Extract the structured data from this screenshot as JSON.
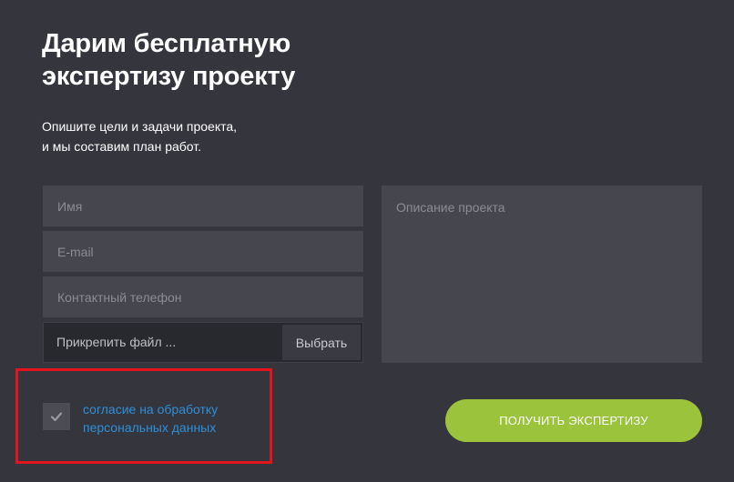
{
  "header": {
    "title_line1": "Дарим бесплатную",
    "title_line2": "экспертизу проекту",
    "subtitle_line1": "Опишите цели и задачи проекта,",
    "subtitle_line2": "и мы составим план работ."
  },
  "form": {
    "name_placeholder": "Имя",
    "email_placeholder": "E-mail",
    "phone_placeholder": "Контактный телефон",
    "file_label": "Прикрепить файл ...",
    "file_button": "Выбрать",
    "description_placeholder": "Описание проекта",
    "consent_line1": "согласие на обработку",
    "consent_line2": "персональных данных",
    "consent_checked": true,
    "submit_label": "ПОЛУЧИТЬ ЭКСПЕРТИЗУ"
  },
  "colors": {
    "background": "#35353d",
    "field": "#46464e",
    "accent_green": "#9bc33b",
    "link_blue": "#2f8fd8",
    "highlight_red": "#e3141b"
  },
  "icons": {
    "checkbox": "check-icon"
  }
}
